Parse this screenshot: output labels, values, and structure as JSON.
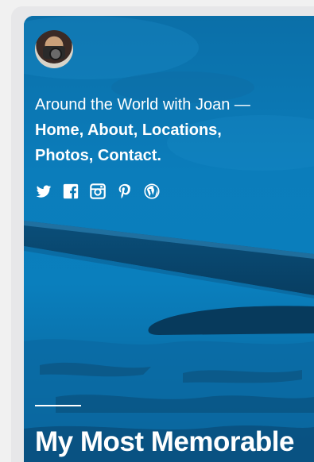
{
  "header": {
    "site_title": "Around the World with Joan",
    "dash": " — ",
    "nav": [
      "Home",
      "About",
      "Locations",
      "Photos",
      "Contact"
    ],
    "separators": [
      ", ",
      ", ",
      ",",
      ", ",
      "."
    ]
  },
  "social_icons": [
    "twitter-icon",
    "facebook-icon",
    "instagram-icon",
    "pinterest-icon",
    "wordpress-icon"
  ],
  "hero": {
    "image_subject": "airplane wing over water",
    "tint_color": "#0876b2"
  },
  "post": {
    "title": "My Most Memorable"
  }
}
